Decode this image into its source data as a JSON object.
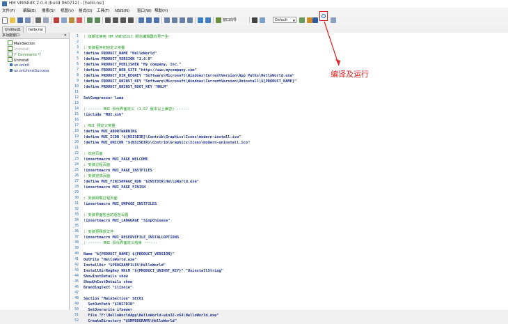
{
  "window": {
    "title": "HM VNISEdit 2.0.3 (build 060712) - [hello.nsi]"
  },
  "menu": [
    "文件(F)",
    "编辑(E)",
    "搜索(S)",
    "视图(V)",
    "格式(O)",
    "工具(T)",
    "NSIS(N)",
    "窗口(W)",
    "帮助(H)"
  ],
  "toolbar": {
    "wizard_label": "窗口向导",
    "syntax_combo": "Default"
  },
  "tabs": [
    {
      "label": "Untitled1"
    },
    {
      "label": "hello.nsi"
    }
  ],
  "sidebar": {
    "header": "多功能窗口",
    "close": "×",
    "items": [
      {
        "label": "MainSection"
      },
      {
        "label": "Uninstall"
      },
      {
        "label": "/* Comments */"
      },
      {
        "label": "Uninstall"
      },
      {
        "label": "un.onInit"
      },
      {
        "label": "un.onUninstSuccess"
      }
    ]
  },
  "code": [
    {
      "n": "1",
      "t": "; 该脚本使用 HM VNISEdit 脚本编辑器向导产生",
      "c": "comment"
    },
    {
      "n": "2",
      "t": "",
      "c": "plain"
    },
    {
      "n": "3",
      "t": "; 安装程序初始定义常量",
      "c": "comment"
    },
    {
      "n": "4",
      "t": "!define PRODUCT_NAME \"HelloWorld\"",
      "c": "kw"
    },
    {
      "n": "5",
      "t": "!define PRODUCT_VERSION \"1.0.0\"",
      "c": "kw"
    },
    {
      "n": "6",
      "t": "!define PRODUCT_PUBLISHER \"My company, Inc.\"",
      "c": "kw"
    },
    {
      "n": "7",
      "t": "!define PRODUCT_WEB_SITE \"http://www.mycompany.com\"",
      "c": "kw"
    },
    {
      "n": "8",
      "t": "!define PRODUCT_DIR_REGKEY \"Software\\Microsoft\\Windows\\CurrentVersion\\App Paths\\HelloWorld.exe\"",
      "c": "kw"
    },
    {
      "n": "9",
      "t": "!define PRODUCT_UNINST_KEY \"Software\\Microsoft\\Windows\\CurrentVersion\\Uninstall\\${PRODUCT_NAME}\"",
      "c": "kw"
    },
    {
      "n": "10",
      "t": "!define PRODUCT_UNINST_ROOT_KEY \"HKLM\"",
      "c": "kw"
    },
    {
      "n": "11",
      "t": "",
      "c": "plain"
    },
    {
      "n": "12",
      "t": "SetCompressor lzma",
      "c": "kw"
    },
    {
      "n": "13",
      "t": "",
      "c": "plain"
    },
    {
      "n": "14",
      "t": "; ------ MUI 现代界面定义 (1.67 版本以上兼容) ------",
      "c": "comment"
    },
    {
      "n": "15",
      "t": "!include \"MUI.nsh\"",
      "c": "kw"
    },
    {
      "n": "16",
      "t": "",
      "c": "plain"
    },
    {
      "n": "17",
      "t": "; MUI 预定义常量",
      "c": "comment"
    },
    {
      "n": "18",
      "t": "!define MUI_ABORTWARNING",
      "c": "kw"
    },
    {
      "n": "19",
      "t": "!define MUI_ICON \"${NSISDIR}\\Contrib\\Graphics\\Icons\\modern-install.ico\"",
      "c": "kw"
    },
    {
      "n": "20",
      "t": "!define MUI_UNICON \"${NSISDIR}\\Contrib\\Graphics\\Icons\\modern-uninstall.ico\"",
      "c": "kw"
    },
    {
      "n": "21",
      "t": "",
      "c": "plain"
    },
    {
      "n": "22",
      "t": "; 欢迎页面",
      "c": "comment"
    },
    {
      "n": "23",
      "t": "!insertmacro MUI_PAGE_WELCOME",
      "c": "kw"
    },
    {
      "n": "24",
      "t": "; 安装过程页面",
      "c": "comment"
    },
    {
      "n": "25",
      "t": "!insertmacro MUI_PAGE_INSTFILES",
      "c": "kw"
    },
    {
      "n": "26",
      "t": "; 安装完成页面",
      "c": "comment"
    },
    {
      "n": "27",
      "t": "!define MUI_FINISHPAGE_RUN \"$INSTDIR\\HelloWorld.exe\"",
      "c": "kw"
    },
    {
      "n": "28",
      "t": "!insertmacro MUI_PAGE_FINISH",
      "c": "kw"
    },
    {
      "n": "29",
      "t": "",
      "c": "plain"
    },
    {
      "n": "30",
      "t": "; 安装卸载过程页面",
      "c": "comment"
    },
    {
      "n": "31",
      "t": "!insertmacro MUI_UNPAGE_INSTFILES",
      "c": "kw"
    },
    {
      "n": "32",
      "t": "",
      "c": "plain"
    },
    {
      "n": "33",
      "t": "; 安装界面包含的语言设置",
      "c": "comment"
    },
    {
      "n": "34",
      "t": "!insertmacro MUI_LANGUAGE \"SimpChinese\"",
      "c": "kw"
    },
    {
      "n": "35",
      "t": "",
      "c": "plain"
    },
    {
      "n": "36",
      "t": "; 安装预释放文件",
      "c": "comment"
    },
    {
      "n": "37",
      "t": "!insertmacro MUI_RESERVEFILE_INSTALLOPTIONS",
      "c": "kw"
    },
    {
      "n": "38",
      "t": "; ------ MUI 现代界面定义结束 ------",
      "c": "comment"
    },
    {
      "n": "39",
      "t": "",
      "c": "plain"
    },
    {
      "n": "40",
      "t": "Name \"${PRODUCT_NAME} ${PRODUCT_VERSION}\"",
      "c": "kw"
    },
    {
      "n": "41",
      "t": "OutFile \"HelloWorld.exe\"",
      "c": "kw"
    },
    {
      "n": "42",
      "t": "InstallDir \"$PROGRAMFILES\\HelloWorld\"",
      "c": "kw"
    },
    {
      "n": "43",
      "t": "InstallDirRegKey HKLM \"${PRODUCT_UNINST_KEY}\" \"UninstallString\"",
      "c": "kw"
    },
    {
      "n": "44",
      "t": "ShowInstDetails show",
      "c": "kw"
    },
    {
      "n": "45",
      "t": "ShowUnInstDetails show",
      "c": "kw"
    },
    {
      "n": "46",
      "t": "BrandingText \"ilinnie\"",
      "c": "kw"
    },
    {
      "n": "47",
      "t": "",
      "c": "plain"
    },
    {
      "n": "48",
      "t": "Section \"MainSection\" SEC01",
      "c": "kw"
    },
    {
      "n": "49",
      "t": "  SetOutPath \"$INSTDIR\"",
      "c": "kw"
    },
    {
      "n": "50",
      "t": "  SetOverwrite ifnewer",
      "c": "kw"
    },
    {
      "n": "51",
      "t": "  File \"F:\\HelloWorldApp\\HelloWorld-win32-x64\\HelloWorld.exe\"",
      "c": "kw"
    },
    {
      "n": "52",
      "t": "  CreateDirectory \"$SMPROGRAMS\\HelloWorld\"",
      "c": "kw"
    }
  ],
  "annotation": {
    "text": "编译及运行"
  },
  "colors": {
    "accent": "#e02020",
    "comment": "#1c9a1c",
    "keyword": "#1a2e8c"
  }
}
